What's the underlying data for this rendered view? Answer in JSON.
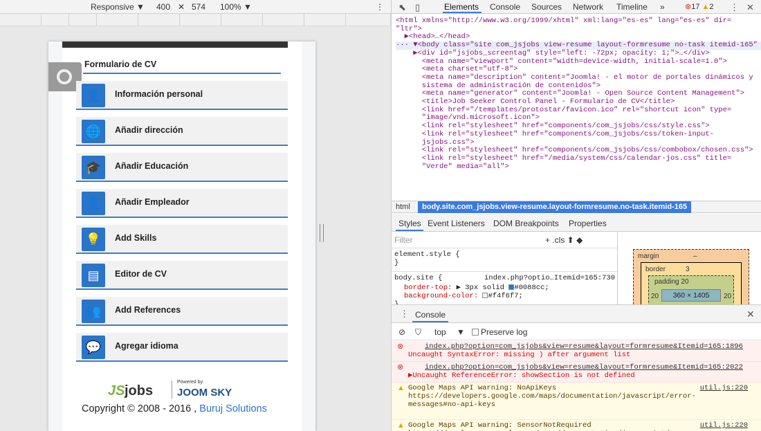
{
  "device_toolbar": {
    "device": "Responsive ▼",
    "width": "400",
    "times": "✕",
    "height": "574",
    "zoom": "100% ▼",
    "more": "⋮"
  },
  "page": {
    "form_title": "Formulario de CV",
    "menu": [
      {
        "label": "Información personal",
        "icon": "user-info-icon",
        "glyph": "👤"
      },
      {
        "label": "Añadir dirección",
        "icon": "globe-icon",
        "glyph": "🌐"
      },
      {
        "label": "Añadir Educación",
        "icon": "graduation-cap-icon",
        "glyph": "🎓"
      },
      {
        "label": "Añadir Empleador",
        "icon": "employer-icon",
        "glyph": "👤"
      },
      {
        "label": "Add Skills",
        "icon": "lightbulb-icon",
        "glyph": "💡"
      },
      {
        "label": "Editor de CV",
        "icon": "document-icon",
        "glyph": "▤"
      },
      {
        "label": "Add References",
        "icon": "group-icon",
        "glyph": "👥"
      },
      {
        "label": "Agregar idioma",
        "icon": "chat-icon",
        "glyph": "💬"
      }
    ],
    "footer": {
      "logo_js": "JS",
      "logo_jobs": "jobs",
      "powered_by": "Powered by:",
      "joomsky": "JOOM SKY",
      "copyright_prefix": "Copyright © 2008 - 2016 ,",
      "copyright_link": "Buruj Solutions"
    }
  },
  "devtools": {
    "tabs": [
      "Elements",
      "Console",
      "Sources",
      "Network",
      "Timeline",
      "»"
    ],
    "active_tab": "Elements",
    "error_count": "17",
    "warning_count": "2",
    "dom_lines": [
      "<html xmlns=\"http://www.w3.org/1999/xhtml\" xml:lang=\"es-es\" lang=\"es-es\" dir=",
      "\"ltr\">",
      "  ▶<head>…</head>",
      "··· ▼<body class=\"site com_jsjobs view-resume layout-formresume no-task itemid-165\"",
      "    ▶<div id=\"jsjobs_screentag\" style=\"left: -72px; opacity: 1;\">…</div>",
      "      <meta name=\"viewport\" content=\"width=device-width, initial-scale=1.0\">",
      "      <meta charset=\"utf-8\">",
      "      <meta name=\"description\" content=\"Joomla! - el motor de portales dinámicos y",
      "      sistema de administración de contenidos\">",
      "      <meta name=\"generator\" content=\"Joomla! - Open Source Content Management\">",
      "      <title>Job Seeker Control Panel - Formulario de CV</title>",
      "      <link href=\"/templates/protostar/favicon.ico\" rel=\"shortcut icon\" type=",
      "      \"image/vnd.microsoft.icon\">",
      "      <link rel=\"stylesheet\" href=\"components/com_jsjobs/css/style.css\">",
      "      <link rel=\"stylesheet\" href=\"components/com_jsjobs/css/token-input-",
      "      jsjobs.css\">",
      "      <link rel=\"stylesheet\" href=\"components/com_jsjobs/css/combobox/chosen.css\">",
      "      <link rel=\"stylesheet\" href=\"/media/system/css/calendar-jos.css\" title=",
      "      \"Verde\" media=\"all\">"
    ],
    "crumb_html": "html",
    "crumb_body": "body.site.com_jsjobs.view-resume.layout-formresume.no-task.itemid-165",
    "sub_tabs": [
      "Styles",
      "Event Listeners",
      "DOM Breakpoints",
      "Properties"
    ],
    "styles": {
      "filter_placeholder": "Filter",
      "filter_tools": "+  .cls  ⬆  ◆",
      "rule1": "element.style {",
      "rule1_close": "}",
      "rule2_selector": "body.site {",
      "rule2_source": "index.php?optio…Itemid=165:730",
      "prop1_name": "border-top:",
      "prop1_value": "▶ 3px solid",
      "prop1_color": "#0088cc;",
      "prop2_name": "background-color:",
      "prop2_color": "#f4f6f7;",
      "rule2_close": "}"
    },
    "box_model": {
      "margin_label": "margin",
      "margin_value": "–",
      "border_label": "border",
      "border_value": "3",
      "padding_label": "padding 20",
      "padding_left": "20",
      "padding_right": "20",
      "content": "360 × 1405",
      "dash": "–"
    },
    "console": {
      "title": "Console",
      "context": "top",
      "preserve_log": "Preserve log",
      "messages": [
        {
          "level": "error",
          "source": "index.php?option=com_jsjobs&view=resume&layout=formresume&Itemid=165:1896",
          "text": "Uncaught SyntaxError: missing ) after argument list"
        },
        {
          "level": "error",
          "source": "index.php?option=com_jsjobs&view=resume&layout=formresume&Itemid=165:2022",
          "text": "▶Uncaught ReferenceError: showSection is not defined"
        },
        {
          "level": "warning",
          "source": "util.js:220",
          "text": "Google Maps API warning: NoApiKeys\nhttps://developers.google.com/maps/documentation/javascript/error-\nmessages#no-api-keys"
        },
        {
          "level": "warning",
          "source": "util.js:220",
          "text": "Google Maps API warning: SensorNotRequired\nhttps://developers.google.com/maps/documentation/javascript/error-"
        }
      ]
    }
  }
}
